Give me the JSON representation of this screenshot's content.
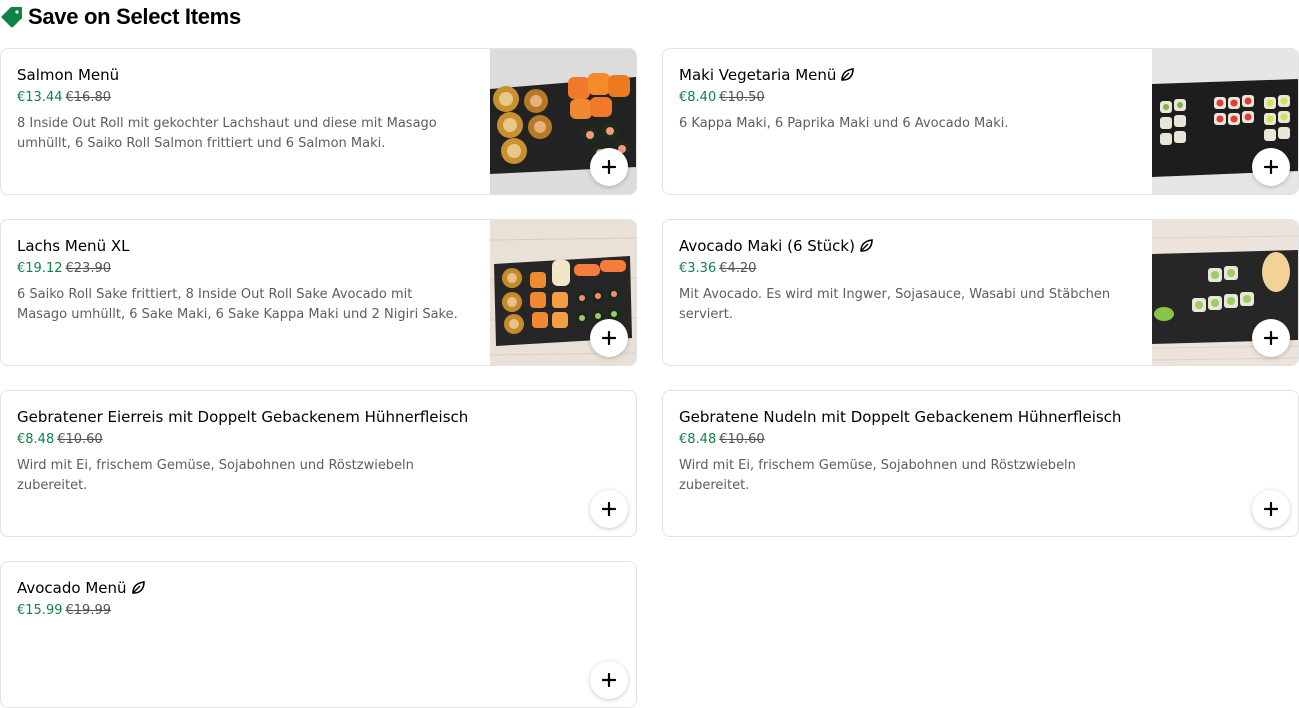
{
  "section": {
    "title": "Save on Select Items",
    "icon": "tag-icon",
    "accent_color": "#0e8345"
  },
  "items": [
    {
      "title": "Salmon Menü",
      "vegetarian": false,
      "price": "€13.44",
      "old_price": "€16.80",
      "description": "8 Inside Out Roll mit gekochter Lachshaut und diese mit Masago umhüllt, 6 Saiko Roll Salmon frittiert und 6 Salmon Maki.",
      "has_image": true
    },
    {
      "title": "Maki Vegetaria Menü",
      "vegetarian": true,
      "price": "€8.40",
      "old_price": "€10.50",
      "description": "6 Kappa Maki, 6 Paprika Maki und 6 Avocado Maki.",
      "has_image": true
    },
    {
      "title": "Lachs Menü XL",
      "vegetarian": false,
      "price": "€19.12",
      "old_price": "€23.90",
      "description": "6 Saiko Roll Sake frittiert, 8 Inside Out Roll Sake Avocado mit Masago umhüllt, 6 Sake Maki, 6 Sake Kappa Maki und 2 Nigiri Sake.",
      "has_image": true
    },
    {
      "title": "Avocado Maki (6 Stück)",
      "vegetarian": true,
      "price": "€3.36",
      "old_price": "€4.20",
      "description": "Mit Avocado. Es wird mit Ingwer, Sojasauce, Wasabi und Stäbchen serviert.",
      "has_image": true
    },
    {
      "title": "Gebratener Eierreis mit Doppelt Gebackenem Hühnerfleisch",
      "vegetarian": false,
      "price": "€8.48",
      "old_price": "€10.60",
      "description": "Wird mit Ei, frischem Gemüse, Sojabohnen und Röstzwiebeln zubereitet.",
      "has_image": false
    },
    {
      "title": "Gebratene Nudeln mit Doppelt Gebackenem Hühnerfleisch",
      "vegetarian": false,
      "price": "€8.48",
      "old_price": "€10.60",
      "description": "Wird mit Ei, frischem Gemüse, Sojabohnen und Röstzwiebeln zubereitet.",
      "has_image": false
    },
    {
      "title": "Avocado Menü",
      "vegetarian": true,
      "price": "€15.99",
      "old_price": "€19.99",
      "description": "",
      "has_image": false
    }
  ],
  "icons": {
    "add": "plus-icon",
    "vegetarian": "leaf-icon"
  }
}
